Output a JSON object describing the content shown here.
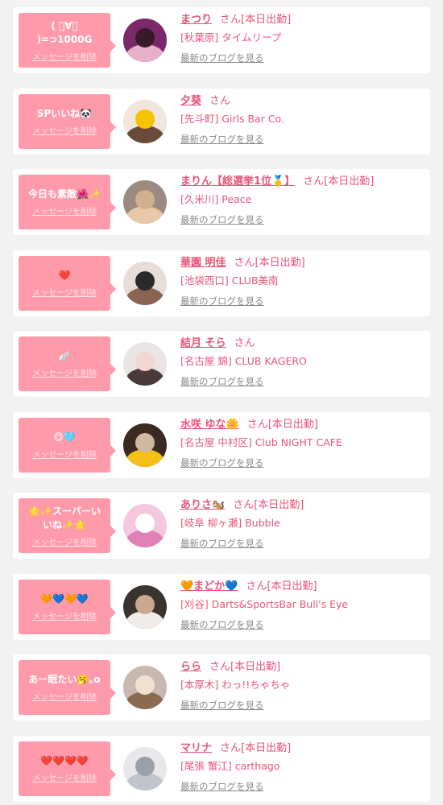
{
  "items": [
    {
      "bubble": "( ﾟ∀ﾟ )=⊃1000G",
      "delete": "メッセージを削除",
      "name": "まつり",
      "suffix": "さん[本日出勤]",
      "shop": "[秋葉原] タイムリープ",
      "blog": "最新のブログを見る",
      "avatar_colors": [
        "#7a2a6a",
        "#e8b0c8",
        "#3a1a2a"
      ]
    },
    {
      "bubble": "SPいいね🐼",
      "delete": "メッセージを削除",
      "name": "夕葵",
      "suffix": "さん",
      "shop": "[先斗町] Girls Bar Co.",
      "blog": "最新のブログを見る",
      "avatar_colors": [
        "#f0e6dc",
        "#6a4a3a",
        "#f5c400"
      ]
    },
    {
      "bubble": "今日も素敵🌺✨",
      "delete": "メッセージを削除",
      "name": "まりん【総選挙1位🥇】",
      "suffix": "さん[本日出勤]",
      "shop": "[久米川] Peace",
      "blog": "最新のブログを見る",
      "avatar_colors": [
        "#9a8a80",
        "#e8c8a8",
        "#d0b090"
      ]
    },
    {
      "bubble": "❤️",
      "delete": "メッセージを削除",
      "name": "華園 明佳",
      "suffix": "さん[本日出勤]",
      "shop": "[池袋西口] CLUB美南",
      "blog": "最新のブログを見る",
      "avatar_colors": [
        "#e8dcd8",
        "#8a6450",
        "#2a2a2a"
      ]
    },
    {
      "bubble": "🪽",
      "delete": "メッセージを削除",
      "name": "結月 そら",
      "suffix": "さん",
      "shop": "[名古屋 錦] CLUB KAGERO",
      "blog": "最新のブログを見る",
      "avatar_colors": [
        "#eae4e4",
        "#4a3a3a",
        "#f0d8d0"
      ]
    },
    {
      "bubble": "😋🩵",
      "delete": "メッセージを削除",
      "name": "水咲 ゆな🌼",
      "suffix": "さん[本日出勤]",
      "shop": "[名古屋 中村区] Club NIGHT CAFE",
      "blog": "最新のブログを見る",
      "avatar_colors": [
        "#3a2a22",
        "#f5c018",
        "#d0b8a0"
      ]
    },
    {
      "bubble": "🌟✨スーパーい\nいね✨🌟",
      "delete": "メッセージを削除",
      "name": "ありさ🐿️",
      "suffix": "さん[本日出勤]",
      "shop": "[岐阜 柳ヶ瀬] Bubble",
      "blog": "最新のブログを見る",
      "avatar_colors": [
        "#f5c8e0",
        "#e080b8",
        "#ffffff"
      ]
    },
    {
      "bubble": "🧡💙🧡💙",
      "delete": "メッセージを削除",
      "name": "🧡まどか💙",
      "suffix": "さん[本日出勤]",
      "shop": "[刈谷] Darts&SportsBar Bull's Eye",
      "blog": "最新のブログを見る",
      "avatar_colors": [
        "#3a3430",
        "#f2ece8",
        "#caa890"
      ]
    },
    {
      "bubble": "あー眠たい🥱｡o",
      "delete": "メッセージを削除",
      "name": "らら",
      "suffix": "さん[本日出勤]",
      "shop": "[本厚木] わっ!!ちゃちゃ",
      "blog": "最新のブログを見る",
      "avatar_colors": [
        "#c8b8b0",
        "#8a6a50",
        "#f0e0d0"
      ]
    },
    {
      "bubble": "❤️❤️❤️❤️",
      "delete": "メッセージを削除",
      "name": "マリナ",
      "suffix": "さん[本日出勤]",
      "shop": "[尾張 蟹江] carthago",
      "blog": "最新のブログを見る",
      "avatar_colors": [
        "#e8e8ec",
        "#c0c4cc",
        "#9aa0aa"
      ]
    }
  ]
}
